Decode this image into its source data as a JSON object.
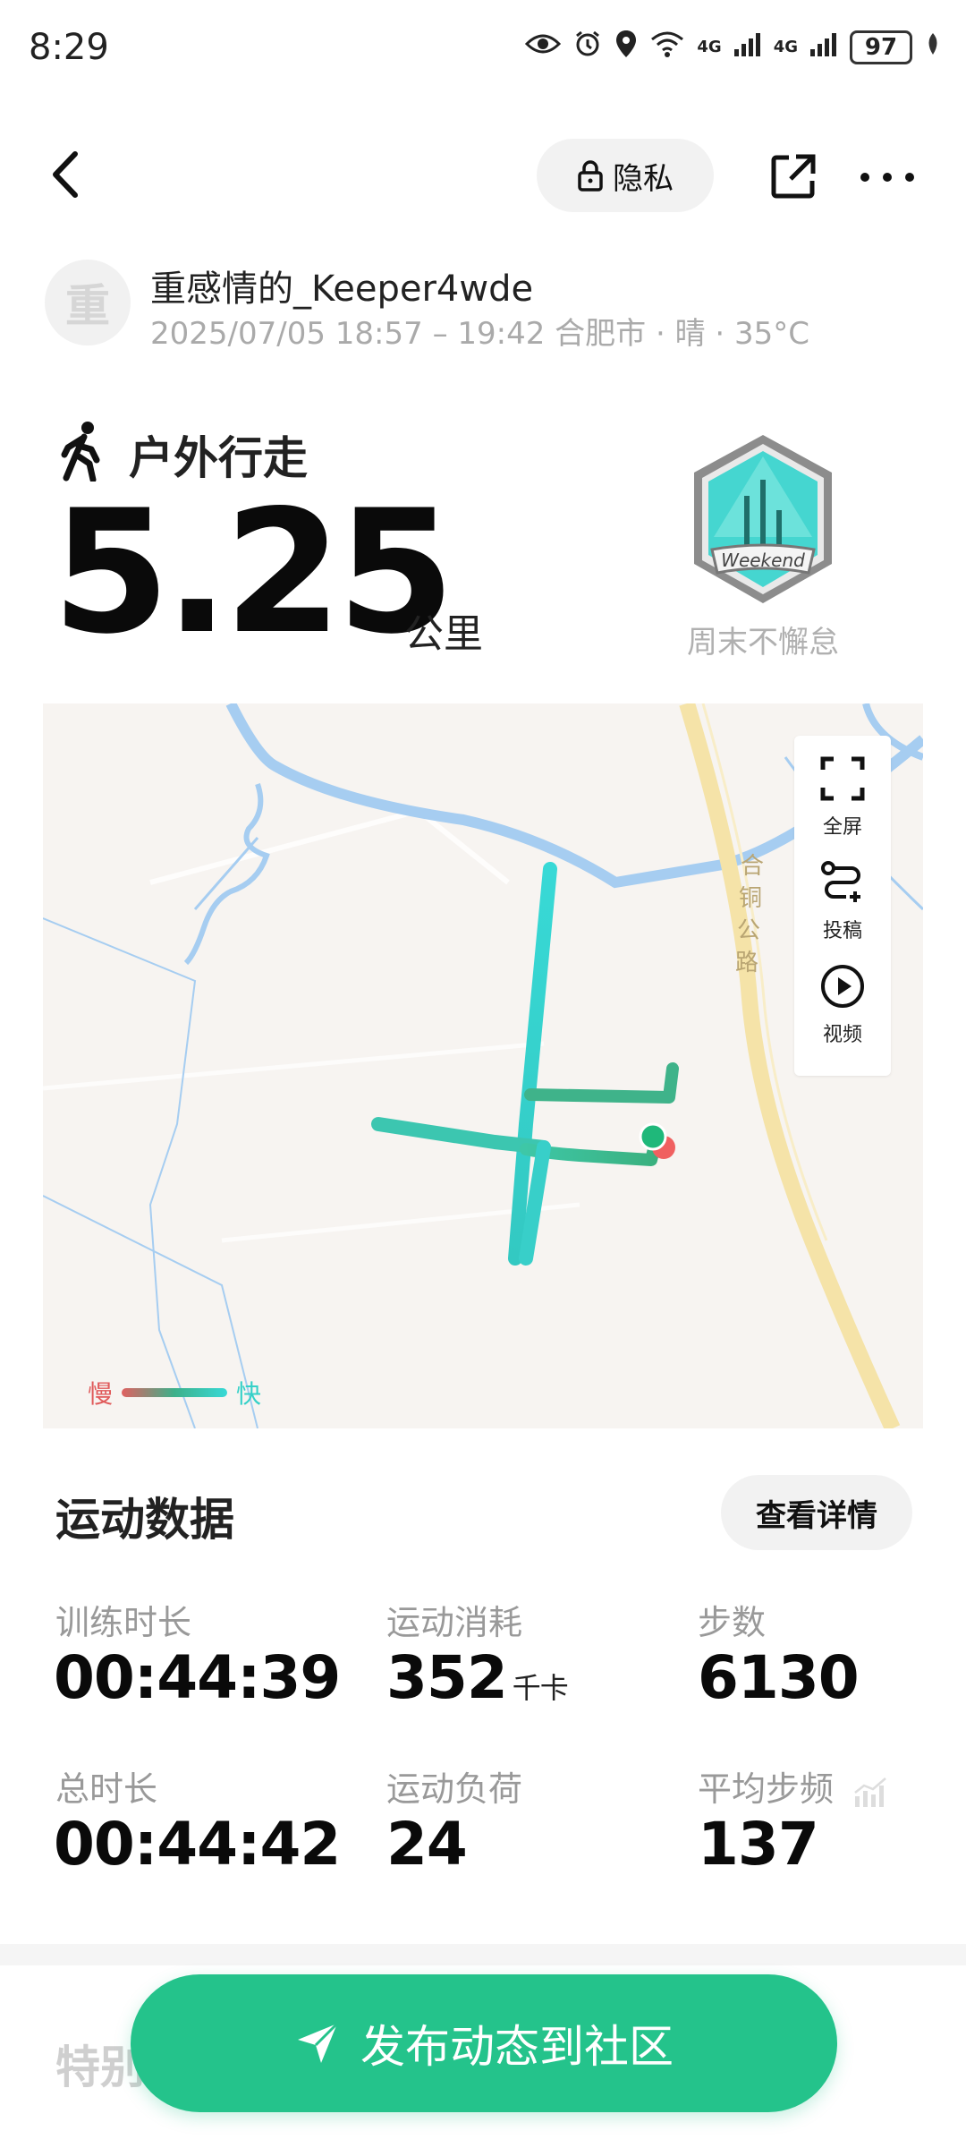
{
  "status_bar": {
    "time": "8:29",
    "network_1": "4G",
    "network_2": "4G",
    "battery": "97"
  },
  "header": {
    "privacy_label": "隐私",
    "icons": [
      "back-icon",
      "lock-icon",
      "share-icon",
      "more-icon"
    ]
  },
  "user": {
    "avatar_char": "重",
    "name": "重感情的_Keeper4wde",
    "meta": "2025/07/05 18:57 – 19:42 合肥市 · 晴 · 35°C"
  },
  "activity": {
    "type": "户外行走",
    "distance": "5.25",
    "unit": "公里",
    "badge_text": "Weekend",
    "badge_label": "周末不懈怠"
  },
  "map": {
    "road_label": "合铜公路",
    "tools": [
      {
        "label": "全屏",
        "icon": "fullscreen-icon"
      },
      {
        "label": "投稿",
        "icon": "route-submit-icon"
      },
      {
        "label": "视频",
        "icon": "play-icon"
      }
    ],
    "legend_slow": "慢",
    "legend_fast": "快",
    "colors": {
      "slow": "#e05a5a",
      "mid": "#3db08a",
      "fast": "#38d9d6",
      "road": "#f5e3a8",
      "river": "#a6cdf1"
    }
  },
  "stats": {
    "title": "运动数据",
    "detail_button": "查看详情",
    "items": [
      {
        "label": "训练时长",
        "value": "00:44:39",
        "unit": ""
      },
      {
        "label": "运动消耗",
        "value": "352",
        "unit": "千卡"
      },
      {
        "label": "步数",
        "value": "6130",
        "unit": ""
      },
      {
        "label": "总时长",
        "value": "00:44:42",
        "unit": ""
      },
      {
        "label": "运动负荷",
        "value": "24",
        "unit": ""
      },
      {
        "label": "平均步频",
        "value": "137",
        "unit": ""
      }
    ]
  },
  "next_section_peek": "特别",
  "publish_button": "发布动态到社区",
  "accent_color": "#24c38b"
}
